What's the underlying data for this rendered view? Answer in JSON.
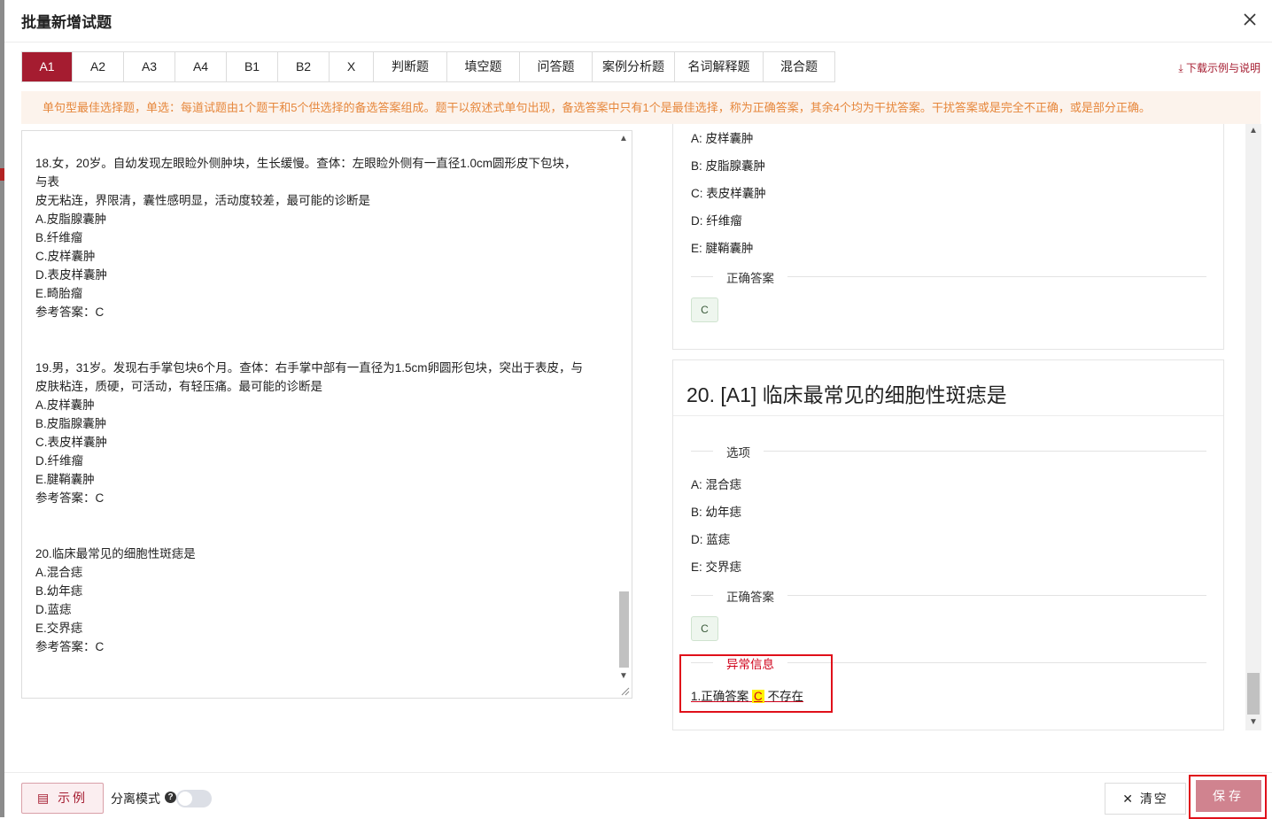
{
  "dialog": {
    "title": "批量新增试题",
    "close_icon": "close-icon"
  },
  "tabs": [
    "A1",
    "A2",
    "A3",
    "A4",
    "B1",
    "B2",
    "X",
    "判断题",
    "填空题",
    "问答题",
    "案例分析题",
    "名词解释题",
    "混合题"
  ],
  "active_tab": "A1",
  "download_link": "⤓ 下载示例与说明",
  "notice": "单句型最佳选择题，单选：每道试题由1个题干和5个供选择的备选答案组成。题干以叙述式单句出现，备选答案中只有1个是最佳选择，称为正确答案，其余4个均为干扰答案。干扰答案或是完全不正确，或是部分正确。",
  "editor": {
    "lines": [
      "18.女，20岁。自幼发现左眼睑外侧肿块，生长缓慢。查体：左眼睑外侧有一直径1.0cm圆形皮下包块，",
      "与表",
      "皮无粘连，界限清，囊性感明显，活动度较差，最可能的诊断是",
      "A.皮脂腺囊肿",
      "B.纤维瘤",
      "C.皮样囊肿",
      "D.表皮样囊肿",
      "E.畸胎瘤",
      "参考答案：C",
      "",
      "",
      "19.男，31岁。发现右手掌包块6个月。查体：右手掌中部有一直径为1.5cm卵圆形包块，突出于表皮，与",
      "皮肤粘连，质硬，可活动，有轻压痛。最可能的诊断是",
      "A.皮样囊肿",
      "B.皮脂腺囊肿",
      "C.表皮样囊肿",
      "D.纤维瘤",
      "E.腱鞘囊肿",
      "参考答案：C",
      "",
      "",
      "20.临床最常见的细胞性斑痣是",
      "A.混合痣",
      "B.幼年痣",
      "D.蓝痣",
      "E.交界痣",
      "参考答案：C"
    ]
  },
  "preview": {
    "card1": {
      "options": [
        "A: 皮样囊肿",
        "B: 皮脂腺囊肿",
        "C: 表皮样囊肿",
        "D: 纤维瘤",
        "E: 腱鞘囊肿"
      ],
      "answer_label": "正确答案",
      "answer": "C"
    },
    "card2": {
      "title": "20. [A1] 临床最常见的细胞性斑痣是",
      "options_label": "选项",
      "options": [
        "A: 混合痣",
        "B: 幼年痣",
        "D: 蓝痣",
        "E: 交界痣"
      ],
      "answer_label": "正确答案",
      "answer": "C",
      "error_label": "异常信息",
      "error_prefix": "1.正确答案",
      "error_value": "C",
      "error_suffix": "不存在"
    }
  },
  "footer": {
    "example_label": "示例",
    "separate_mode_label": "分离模式",
    "help_icon": "?",
    "separate_mode_on": false,
    "clear_label": "清空",
    "save_label": "保存"
  },
  "colors": {
    "brand": "#a51c30",
    "notice_text": "#e6873c",
    "notice_bg": "#fcf3ec",
    "error": "#d0021b",
    "highlight": "#fff200"
  }
}
